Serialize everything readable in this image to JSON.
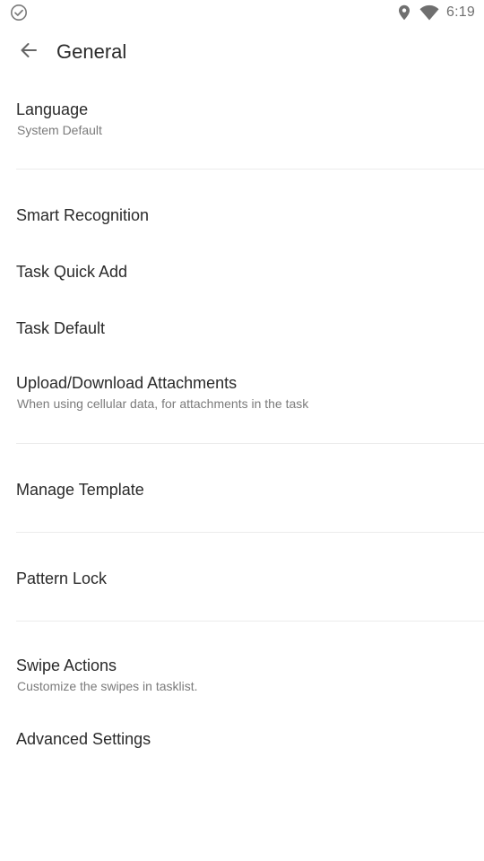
{
  "status_bar": {
    "left_icon": "check-circle-icon",
    "time": "6:19",
    "icons": [
      "location-icon",
      "wifi-icon"
    ]
  },
  "toolbar": {
    "back_icon": "arrow-left-icon",
    "title": "General"
  },
  "settings": {
    "language": {
      "title": "Language",
      "subtitle": "System Default"
    },
    "smart_recognition": {
      "title": "Smart Recognition"
    },
    "task_quick_add": {
      "title": "Task Quick Add"
    },
    "task_default": {
      "title": "Task Default"
    },
    "upload_download": {
      "title": "Upload/Download Attachments",
      "subtitle": "When using cellular data, for attachments in the task"
    },
    "manage_template": {
      "title": "Manage Template"
    },
    "pattern_lock": {
      "title": "Pattern Lock"
    },
    "swipe_actions": {
      "title": "Swipe Actions",
      "subtitle": "Customize the swipes in tasklist."
    },
    "advanced_settings": {
      "title": "Advanced Settings"
    }
  },
  "colors": {
    "background": "#ffffff",
    "text_primary": "#2a2a2a",
    "text_secondary": "#7b7b7b",
    "divider": "#ececec",
    "icon": "#6f6f6f"
  }
}
